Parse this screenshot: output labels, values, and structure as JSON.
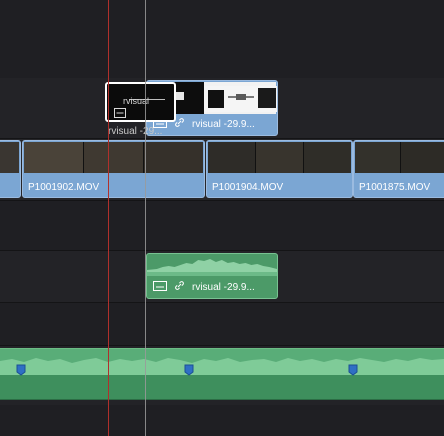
{
  "timeline": {
    "title_clip": {
      "name": "rvisual -29.9..."
    },
    "drag_ghost": {
      "glyph_text": "rvisual",
      "caption": "rvisual -29..."
    },
    "video_clips": [
      {
        "name": "P1001902.MOV"
      },
      {
        "name": "P1001904.MOV"
      },
      {
        "name": "P1001875.MOV"
      }
    ],
    "audio_clip": {
      "name": "rvisual -29.9..."
    }
  },
  "colors": {
    "background": "#1f1f23",
    "video_clip": "#7ba6d3",
    "audio_clip": "#4c9a68",
    "playhead": "#b0302c",
    "marker": "#2f6fc4"
  }
}
